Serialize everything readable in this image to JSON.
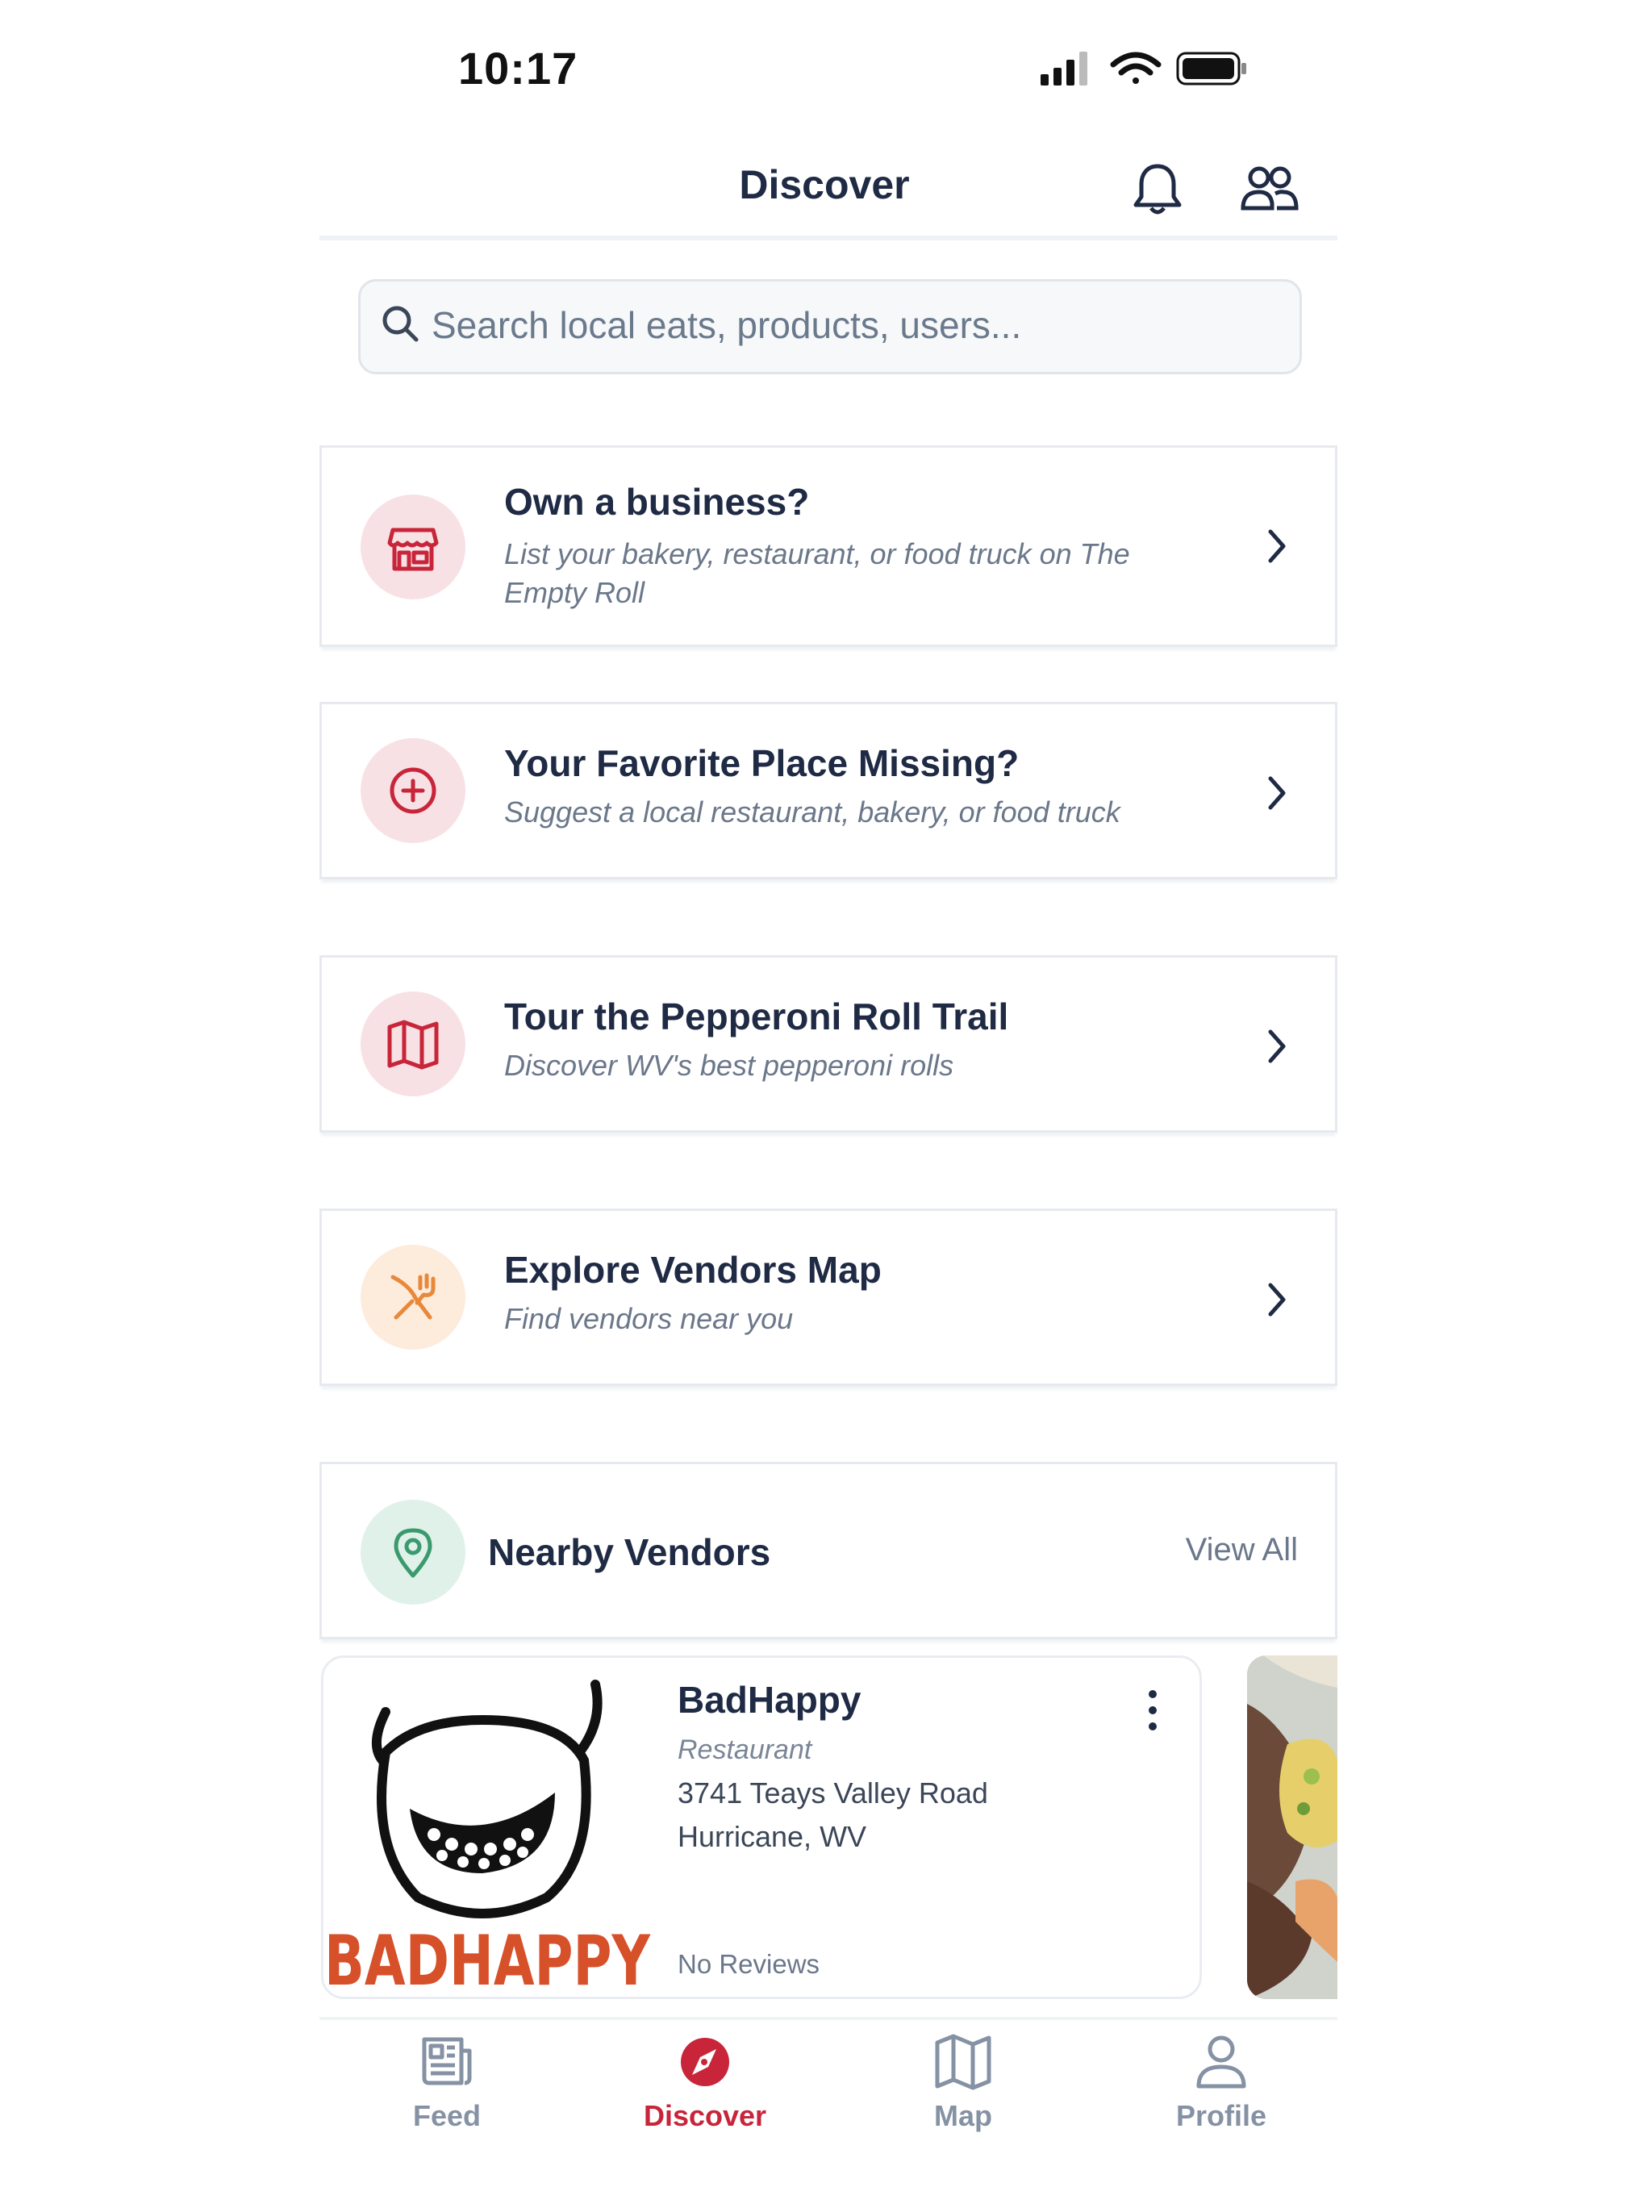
{
  "status_bar": {
    "time": "10:17"
  },
  "header": {
    "title": "Discover"
  },
  "search": {
    "placeholder": "Search local eats, products, users..."
  },
  "cards": [
    {
      "title": "Own a business?",
      "subtitle": "List your bakery, restaurant, or food truck on The Empty Roll",
      "icon": "storefront-icon"
    },
    {
      "title": "Your Favorite Place Missing?",
      "subtitle": "Suggest a local restaurant, bakery, or food truck",
      "icon": "plus-circle-icon"
    },
    {
      "title": "Tour the Pepperoni Roll Trail",
      "subtitle": "Discover WV's best pepperoni rolls",
      "icon": "map-icon"
    },
    {
      "title": "Explore Vendors Map",
      "subtitle": "Find vendors near you",
      "icon": "utensils-icon"
    }
  ],
  "nearby": {
    "title": "Nearby Vendors",
    "view_all": "View All",
    "icon": "location-pin-icon"
  },
  "vendor": {
    "name": "BadHappy",
    "type": "Restaurant",
    "address_line1": "3741 Teays Valley Road",
    "address_line2": "Hurricane, WV",
    "reviews": "No Reviews",
    "logo_text": "BADHAPPY"
  },
  "tabs": [
    {
      "label": "Feed",
      "icon": "newspaper-icon",
      "active": false
    },
    {
      "label": "Discover",
      "icon": "compass-icon",
      "active": true
    },
    {
      "label": "Map",
      "icon": "map-icon",
      "active": false
    },
    {
      "label": "Profile",
      "icon": "person-icon",
      "active": false
    }
  ],
  "colors": {
    "accent": "#c8253a",
    "navy": "#1f2a44",
    "muted": "#6b778a",
    "bubble_red": "#f8e1e4",
    "bubble_orange": "#fdebdc",
    "bubble_green": "#e0f1ea"
  }
}
